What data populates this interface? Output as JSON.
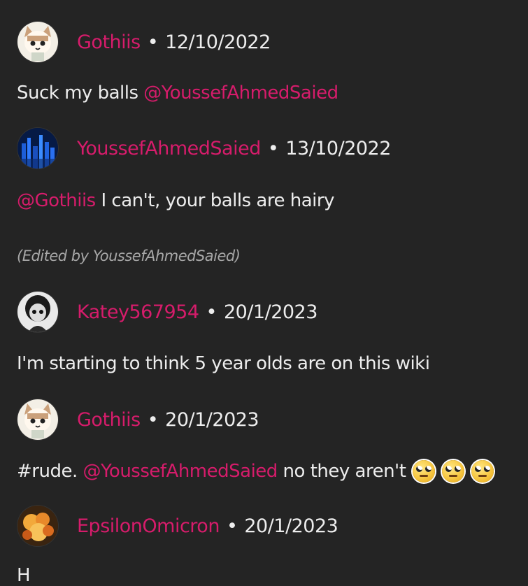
{
  "comments": [
    {
      "author": "Gothiis",
      "separator": "•",
      "date": "12/10/2022",
      "avatar_icon": "cat-avatar-icon",
      "text_before": "Suck my balls ",
      "mention": "@YoussefAhmedSaied",
      "text_after": ""
    },
    {
      "author": "YoussefAhmedSaied",
      "separator": "•",
      "date": "13/10/2022",
      "avatar_icon": "blue-city-avatar-icon",
      "mention": "@Gothiis",
      "text_after": " I can't, your balls are hairy",
      "edited": "(Edited by YoussefAhmedSaied)"
    },
    {
      "author": "Katey567954",
      "separator": "•",
      "date": "20/1/2023",
      "avatar_icon": "doll-avatar-icon",
      "text": "I'm starting to think 5 year olds are on this wiki"
    },
    {
      "author": "Gothiis",
      "separator": "•",
      "date": "20/1/2023",
      "avatar_icon": "cat-avatar-icon",
      "text_before": "#rude. ",
      "mention": "@YoussefAhmedSaied",
      "text_after": " no they aren't",
      "emoji_icons": [
        "eye-roll-emoji-icon",
        "eye-roll-emoji-icon",
        "eye-roll-emoji-icon"
      ]
    },
    {
      "author": "EpsilonOmicron",
      "separator": "•",
      "date": "20/1/2023",
      "avatar_icon": "food-avatar-icon",
      "text": "H"
    }
  ],
  "colors": {
    "background": "#242424",
    "username": "#d61c6b",
    "text": "#ededed",
    "edited": "#a7a7a7"
  }
}
